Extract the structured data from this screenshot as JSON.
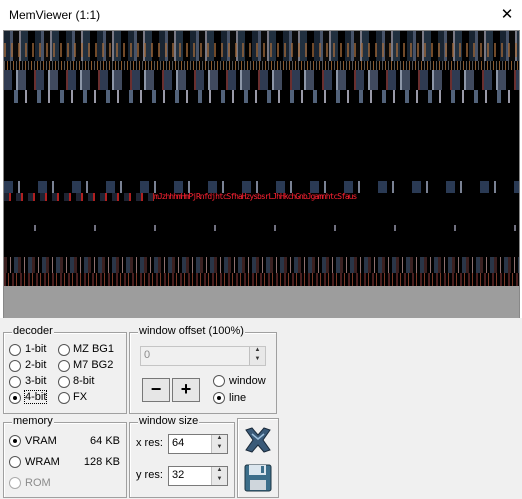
{
  "window": {
    "title": "MemViewer (1:1)",
    "close_glyph": "✕"
  },
  "viewer": {
    "text_row": "mJzhhhmHmPjRnfdjhtcSfhaHzysbsrLJhHkchGnbJgamnhtcSfaus"
  },
  "decoder": {
    "legend": "decoder",
    "options": [
      {
        "label": "1-bit",
        "selected": false
      },
      {
        "label": "MZ BG1",
        "selected": false
      },
      {
        "label": "2-bit",
        "selected": false
      },
      {
        "label": "M7 BG2",
        "selected": false
      },
      {
        "label": "3-bit",
        "selected": false
      },
      {
        "label": "8-bit",
        "selected": false
      },
      {
        "label": "4-bit",
        "selected": true
      },
      {
        "label": "FX",
        "selected": false
      }
    ]
  },
  "window_offset": {
    "legend": "window offset (100%)",
    "value": "0",
    "minus": "−",
    "plus": "+",
    "modes": [
      {
        "label": "window",
        "selected": false
      },
      {
        "label": "line",
        "selected": true
      }
    ]
  },
  "memory": {
    "legend": "memory",
    "options": [
      {
        "label": "VRAM",
        "size": "64 KB",
        "selected": true,
        "enabled": true
      },
      {
        "label": "WRAM",
        "size": "128 KB",
        "selected": false,
        "enabled": true
      },
      {
        "label": "ROM",
        "size": "",
        "selected": false,
        "enabled": false
      }
    ]
  },
  "window_size": {
    "legend": "window size",
    "x_label": "x res:",
    "x_value": "64",
    "y_label": "y res:",
    "y_value": "32"
  },
  "actions": {
    "tools_icon": "tools-icon",
    "save_icon": "save-icon"
  },
  "colors": {
    "title_bg": "#ffffff",
    "panel_bg": "#f0f0f0",
    "viewer_bg": "#000000",
    "pixel_red": "#ff2030"
  }
}
